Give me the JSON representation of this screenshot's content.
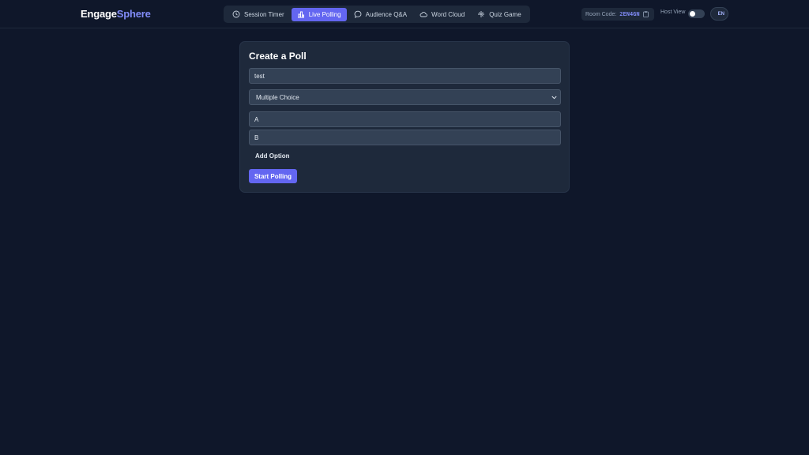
{
  "app": {
    "logo_part1": "Engage",
    "logo_part2": "Sphere"
  },
  "nav": {
    "items": [
      {
        "label": "Session Timer",
        "icon": "clock-icon",
        "active": false
      },
      {
        "label": "Live Polling",
        "icon": "bar-chart-icon",
        "active": true
      },
      {
        "label": "Audience Q&A",
        "icon": "chat-bubble-icon",
        "active": false
      },
      {
        "label": "Word Cloud",
        "icon": "cloud-icon",
        "active": false
      },
      {
        "label": "Quiz Game",
        "icon": "gamepad-icon",
        "active": false
      }
    ]
  },
  "room": {
    "label": "Room Code:",
    "code": "2EN4GN",
    "icon": "clipboard-icon"
  },
  "host_view": {
    "label": "Host View",
    "enabled": false
  },
  "language": {
    "current": "EN"
  },
  "poll_form": {
    "title": "Create a Poll",
    "question_value": "test",
    "poll_type": "Multiple Choice",
    "options": [
      "A",
      "B"
    ],
    "add_option_label": "Add Option",
    "submit_label": "Start Polling"
  },
  "colors": {
    "background": "#0f172a",
    "card": "#1e293b",
    "accent": "#6366f1",
    "input": "#334155"
  }
}
